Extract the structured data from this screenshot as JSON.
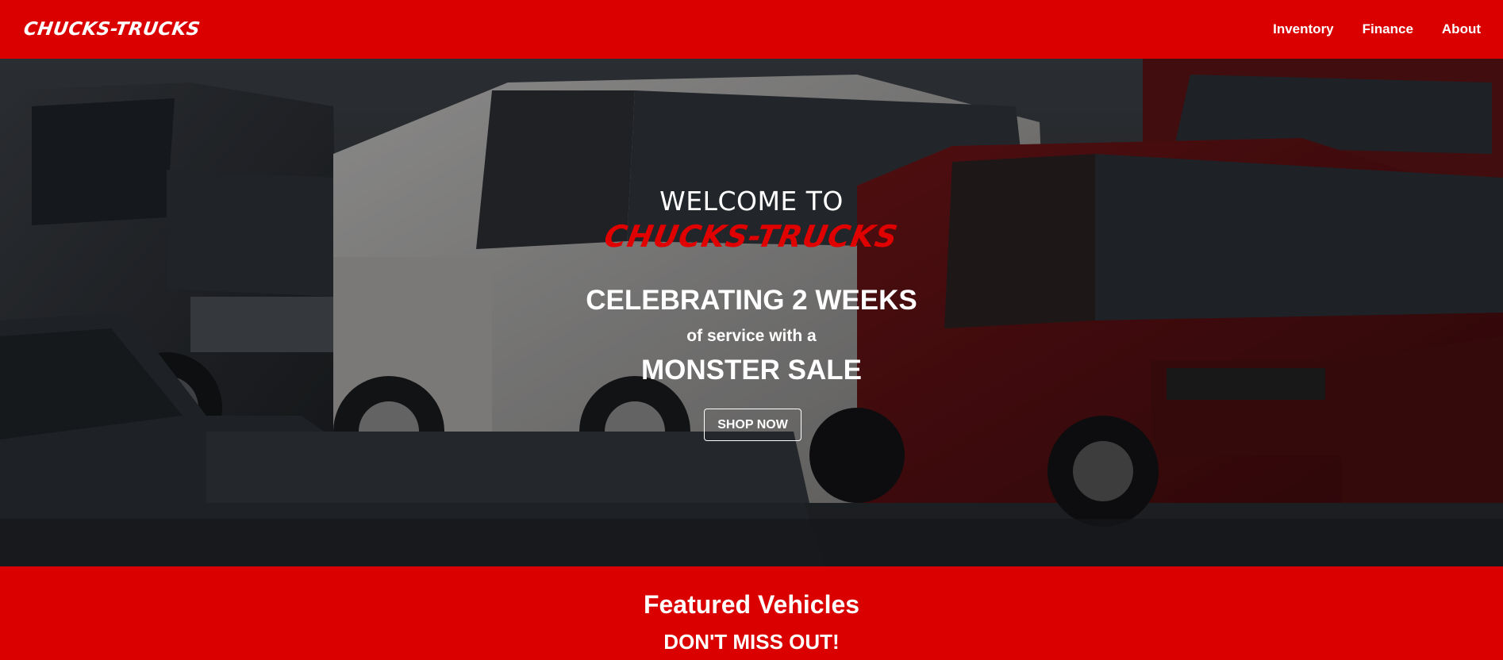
{
  "header": {
    "logo": "CHUCKS-TRUCKS",
    "nav": [
      {
        "label": "Inventory"
      },
      {
        "label": "Finance"
      },
      {
        "label": "About"
      }
    ]
  },
  "hero": {
    "welcome": "WELCOME TO",
    "brand": "CHUCKS-TRUCKS",
    "headline": "CELEBRATING 2 WEEKS",
    "subline": "of service with a",
    "sale": "MONSTER SALE",
    "cta_label": "SHOP NOW",
    "background_image": "pickup-trucks-photo"
  },
  "featured": {
    "title": "Featured Vehicles",
    "subtitle": "DON'T MISS OUT!"
  },
  "colors": {
    "brand_red": "#da0000",
    "text": "#ffffff"
  }
}
